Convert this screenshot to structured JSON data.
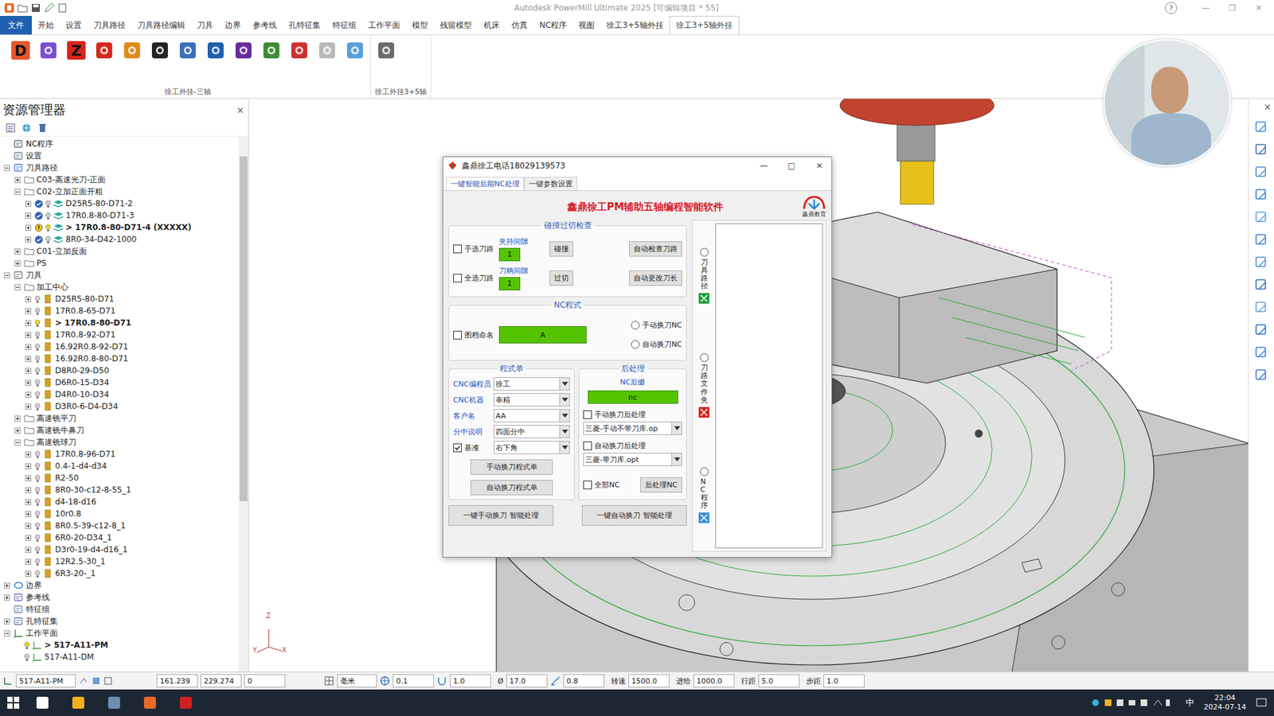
{
  "window": {
    "title": "Autodesk PowerMill Ultimate 2025   [可编辑项目 * 55]",
    "help": "?",
    "controls": [
      "—",
      "❐",
      "✕"
    ]
  },
  "ribbon_tabs": [
    {
      "label": "文件",
      "selected": false,
      "kind": "file"
    },
    {
      "label": "开始",
      "selected": false,
      "kind": "tab"
    },
    {
      "label": "设置",
      "selected": false,
      "kind": "tab"
    },
    {
      "label": "刀具路径",
      "selected": false,
      "kind": "tab"
    },
    {
      "label": "刀具路径编辑",
      "selected": false,
      "kind": "tab"
    },
    {
      "label": "刀具",
      "selected": false,
      "kind": "tab"
    },
    {
      "label": "边界",
      "selected": false,
      "kind": "tab"
    },
    {
      "label": "参考线",
      "selected": false,
      "kind": "tab"
    },
    {
      "label": "孔特征集",
      "selected": false,
      "kind": "tab"
    },
    {
      "label": "特征组",
      "selected": false,
      "kind": "tab"
    },
    {
      "label": "工作平面",
      "selected": false,
      "kind": "tab"
    },
    {
      "label": "模型",
      "selected": false,
      "kind": "tab"
    },
    {
      "label": "残留模型",
      "selected": false,
      "kind": "tab"
    },
    {
      "label": "机床",
      "selected": false,
      "kind": "tab"
    },
    {
      "label": "仿真",
      "selected": false,
      "kind": "tab"
    },
    {
      "label": "NC程序",
      "selected": false,
      "kind": "tab"
    },
    {
      "label": "视图",
      "selected": false,
      "kind": "tab"
    },
    {
      "label": "徐工3+5轴外挂",
      "selected": false,
      "kind": "tab"
    },
    {
      "label": "徐工3+5轴外挂",
      "selected": true,
      "kind": "tab"
    }
  ],
  "ribbon_groups": [
    {
      "label": "徐工外挂-三轴",
      "icons": [
        {
          "kind": "letter",
          "glyph": "D",
          "color": "#e8562a"
        },
        {
          "kind": "symbol",
          "color": "#7b4fd0"
        },
        {
          "kind": "letter",
          "glyph": "Z",
          "color": "#d8241c"
        },
        {
          "kind": "symbol",
          "color": "#d42a1e"
        },
        {
          "kind": "symbol",
          "color": "#e08a1c"
        },
        {
          "kind": "symbol",
          "color": "#222222"
        },
        {
          "kind": "symbol",
          "color": "#3a6fb8"
        },
        {
          "kind": "symbol",
          "color": "#1f5fb0"
        },
        {
          "kind": "symbol",
          "color": "#6a2a9a"
        },
        {
          "kind": "symbol",
          "color": "#3f8a3a"
        },
        {
          "kind": "symbol",
          "color": "#cf2f2f"
        },
        {
          "kind": "symbol",
          "color": "#b9b9b9"
        },
        {
          "kind": "symbol",
          "color": "#5aa0d8"
        }
      ]
    },
    {
      "label": "徐工外挂3+5轴",
      "icons": [
        {
          "kind": "symbol",
          "color": "#6b6b6b"
        }
      ]
    }
  ],
  "explorer": {
    "title": "资源管理器",
    "close": "×",
    "items": [
      {
        "label": "NC程序",
        "depth": 0,
        "expandable": false,
        "expanded": false,
        "kind": "nc",
        "current": false
      },
      {
        "label": "设置",
        "depth": 0,
        "expandable": false,
        "expanded": false,
        "kind": "settings",
        "current": false
      },
      {
        "label": "刀具路径",
        "depth": 0,
        "expandable": true,
        "expanded": true,
        "kind": "toolpaths",
        "current": false
      },
      {
        "label": "C03-高速光刀-正面",
        "depth": 1,
        "expandable": true,
        "expanded": false,
        "kind": "folder",
        "current": false
      },
      {
        "label": "C02-立加正面开粗",
        "depth": 1,
        "expandable": true,
        "expanded": true,
        "kind": "folder",
        "current": false
      },
      {
        "label": "D25R5-80-D71-2",
        "depth": 2,
        "expandable": true,
        "expanded": false,
        "kind": "toolpath",
        "current": false,
        "valid": true
      },
      {
        "label": "17R0.8-80-D71-3",
        "depth": 2,
        "expandable": true,
        "expanded": false,
        "kind": "toolpath",
        "current": false,
        "valid": true
      },
      {
        "label": "> 17R0.8-80-D71-4  (XXXXX)",
        "depth": 2,
        "expandable": true,
        "expanded": false,
        "kind": "toolpath",
        "current": true,
        "valid": false
      },
      {
        "label": "8R0-34-D42-1000",
        "depth": 2,
        "expandable": true,
        "expanded": false,
        "kind": "toolpath",
        "current": false,
        "valid": true
      },
      {
        "label": "C01-立加反面",
        "depth": 1,
        "expandable": true,
        "expanded": false,
        "kind": "folder",
        "current": false
      },
      {
        "label": "PS",
        "depth": 1,
        "expandable": true,
        "expanded": false,
        "kind": "folder",
        "current": false
      },
      {
        "label": "刀具",
        "depth": 0,
        "expandable": true,
        "expanded": true,
        "kind": "tools",
        "current": false
      },
      {
        "label": "加工中心",
        "depth": 1,
        "expandable": true,
        "expanded": true,
        "kind": "folder",
        "current": false
      },
      {
        "label": "D25R5-80-D71",
        "depth": 2,
        "expandable": true,
        "expanded": false,
        "kind": "tool",
        "current": false
      },
      {
        "label": "17R0.8-65-D71",
        "depth": 2,
        "expandable": true,
        "expanded": false,
        "kind": "tool",
        "current": false
      },
      {
        "label": "> 17R0.8-80-D71",
        "depth": 2,
        "expandable": true,
        "expanded": false,
        "kind": "tool",
        "current": true
      },
      {
        "label": "17R0.8-92-D71",
        "depth": 2,
        "expandable": true,
        "expanded": false,
        "kind": "tool",
        "current": false
      },
      {
        "label": "16.92R0.8-92-D71",
        "depth": 2,
        "expandable": true,
        "expanded": false,
        "kind": "tool",
        "current": false
      },
      {
        "label": "16.92R0.8-80-D71",
        "depth": 2,
        "expandable": true,
        "expanded": false,
        "kind": "tool",
        "current": false
      },
      {
        "label": "D8R0-29-D50",
        "depth": 2,
        "expandable": true,
        "expanded": false,
        "kind": "tool",
        "current": false
      },
      {
        "label": "D6R0-15-D34",
        "depth": 2,
        "expandable": true,
        "expanded": false,
        "kind": "tool",
        "current": false
      },
      {
        "label": "D4R0-10-D34",
        "depth": 2,
        "expandable": true,
        "expanded": false,
        "kind": "tool",
        "current": false
      },
      {
        "label": "D3R0-6-D4-D34",
        "depth": 2,
        "expandable": true,
        "expanded": false,
        "kind": "tool",
        "current": false
      },
      {
        "label": "高速铣平刀",
        "depth": 1,
        "expandable": true,
        "expanded": false,
        "kind": "folder",
        "current": false
      },
      {
        "label": "高速铣牛鼻刀",
        "depth": 1,
        "expandable": true,
        "expanded": false,
        "kind": "folder",
        "current": false
      },
      {
        "label": "高速铣球刀",
        "depth": 1,
        "expandable": true,
        "expanded": true,
        "kind": "folder",
        "current": false
      },
      {
        "label": "17R0.8-96-D71",
        "depth": 2,
        "expandable": true,
        "expanded": false,
        "kind": "tool",
        "current": false
      },
      {
        "label": "0.4-1-d4-d34",
        "depth": 2,
        "expandable": true,
        "expanded": false,
        "kind": "tool",
        "current": false
      },
      {
        "label": "R2-50",
        "depth": 2,
        "expandable": true,
        "expanded": false,
        "kind": "tool",
        "current": false
      },
      {
        "label": "8R0-30-c12-8-55_1",
        "depth": 2,
        "expandable": true,
        "expanded": false,
        "kind": "tool",
        "current": false
      },
      {
        "label": "d4-18-d16",
        "depth": 2,
        "expandable": true,
        "expanded": false,
        "kind": "tool",
        "current": false
      },
      {
        "label": "10r0.8",
        "depth": 2,
        "expandable": true,
        "expanded": false,
        "kind": "tool",
        "current": false
      },
      {
        "label": "8R0.5-39-c12-8_1",
        "depth": 2,
        "expandable": true,
        "expanded": false,
        "kind": "tool",
        "current": false
      },
      {
        "label": "6R0-20-D34_1",
        "depth": 2,
        "expandable": true,
        "expanded": false,
        "kind": "tool",
        "current": false
      },
      {
        "label": "D3r0-19-d4-d16_1",
        "depth": 2,
        "expandable": true,
        "expanded": false,
        "kind": "tool",
        "current": false
      },
      {
        "label": "12R2.5-30_1",
        "depth": 2,
        "expandable": true,
        "expanded": false,
        "kind": "tool",
        "current": false
      },
      {
        "label": "6R3-20-_1",
        "depth": 2,
        "expandable": true,
        "expanded": false,
        "kind": "tool",
        "current": false
      },
      {
        "label": "边界",
        "depth": 0,
        "expandable": true,
        "expanded": false,
        "kind": "boundary",
        "current": false
      },
      {
        "label": "参考线",
        "depth": 0,
        "expandable": true,
        "expanded": false,
        "kind": "pattern",
        "current": false
      },
      {
        "label": "特征组",
        "depth": 0,
        "expandable": false,
        "expanded": false,
        "kind": "featuregroup",
        "current": false
      },
      {
        "label": "孔特征集",
        "depth": 0,
        "expandable": true,
        "expanded": false,
        "kind": "holes",
        "current": false
      },
      {
        "label": "工作平面",
        "depth": 0,
        "expandable": true,
        "expanded": true,
        "kind": "workplanes",
        "current": false
      },
      {
        "label": "> 517-A11-PM",
        "depth": 1,
        "expandable": false,
        "expanded": false,
        "kind": "workplane",
        "current": true
      },
      {
        "label": "517-A11-DM",
        "depth": 1,
        "expandable": false,
        "expanded": false,
        "kind": "workplane",
        "current": false
      }
    ]
  },
  "viewport": {
    "axes": [
      "Z",
      "Y",
      "X"
    ],
    "close": "×"
  },
  "dialog": {
    "title": "鑫鼎徐工电话18029139573",
    "controls": [
      "—",
      "□",
      "✕"
    ],
    "tabs": [
      {
        "label": "一键智能后期NC处理",
        "selected": true
      },
      {
        "label": "一键参数设置",
        "selected": false
      }
    ],
    "heading": "鑫鼎徐工PM辅助五轴编程智能软件",
    "logo_text": "鑫鼎教育",
    "collision": {
      "title": "碰撞过切检查",
      "rows": [
        {
          "check_label": "手选刀路",
          "checked": false,
          "field_label": "夹持间隙",
          "value": "1",
          "action": "碰撞",
          "auto": "自动检查刀路"
        },
        {
          "check_label": "全选刀路",
          "checked": false,
          "field_label": "刀柄间隙",
          "value": "1",
          "action": "过切",
          "auto": "自动更改刀长"
        }
      ]
    },
    "nc": {
      "title": "NC程式",
      "name_label": "图档命名",
      "name_checked": false,
      "name_value": "A",
      "radios": [
        {
          "label": "手动换刀NC",
          "selected": false
        },
        {
          "label": "自动换刀NC",
          "selected": false
        }
      ]
    },
    "sheet": {
      "title": "程式单",
      "fields": [
        {
          "label": "CNC编程员",
          "value": "徐工"
        },
        {
          "label": "CNC机器",
          "value": "奉精"
        },
        {
          "label": "客户名",
          "value": "AA"
        },
        {
          "label": "分中说明",
          "value": "四面分中"
        }
      ],
      "base": {
        "label": "基准",
        "checked": true,
        "value": "右下角"
      },
      "buttons": [
        "手动换刀程式单",
        "自动换刀程式单"
      ]
    },
    "post": {
      "title": "后处理",
      "suffix_label": "NC后缀",
      "suffix": "nc",
      "options": [
        {
          "label": "手动换刀后处理",
          "checked": false,
          "value": "三菱-手动不带刀库.op"
        },
        {
          "label": "自动换刀后处理",
          "checked": false,
          "value": "三菱-带刀库.opt"
        }
      ],
      "all_label": "全部NC",
      "all_checked": false,
      "button": "后处理NC"
    },
    "bottom_buttons": [
      "一键手动换刀 智能处理",
      "一键自动换刀 智能处理"
    ],
    "sources": [
      {
        "label": "刀具路径",
        "selected": false,
        "color": "#1e9e3a"
      },
      {
        "label": "刀路文件夹",
        "selected": false,
        "color": "#d8261c"
      },
      {
        "label": "NC程序",
        "selected": false,
        "color": "#3c8fd6"
      }
    ]
  },
  "status_bar": {
    "workplane": "517-A11-PM",
    "coords": [
      "161.239",
      "229.274",
      "0"
    ],
    "units": "毫米",
    "fields": [
      {
        "kind": "icon",
        "icon": "target",
        "value": "0.1"
      },
      {
        "kind": "icon",
        "icon": "thickness",
        "value": "1.0"
      },
      {
        "kind": "label",
        "label": "Ø",
        "value": "17.0"
      },
      {
        "kind": "icon",
        "icon": "stepdown",
        "value": "0.8"
      },
      {
        "kind": "label",
        "label": "转速",
        "value": "1500.0"
      },
      {
        "kind": "label",
        "label": "进给",
        "value": "1000.0"
      },
      {
        "kind": "label",
        "label": "行距",
        "value": "5.0"
      },
      {
        "kind": "label",
        "label": "步距",
        "value": "1.0"
      }
    ]
  },
  "taskbar": {
    "apps": [
      {
        "color": "#ffffff"
      },
      {
        "color": "#f2b01e"
      },
      {
        "color": "#6d8fb3"
      },
      {
        "color": "#e8692a"
      },
      {
        "color": "#d22020"
      }
    ],
    "ime": "中",
    "time": "22:04",
    "date": "2024-07-14"
  }
}
